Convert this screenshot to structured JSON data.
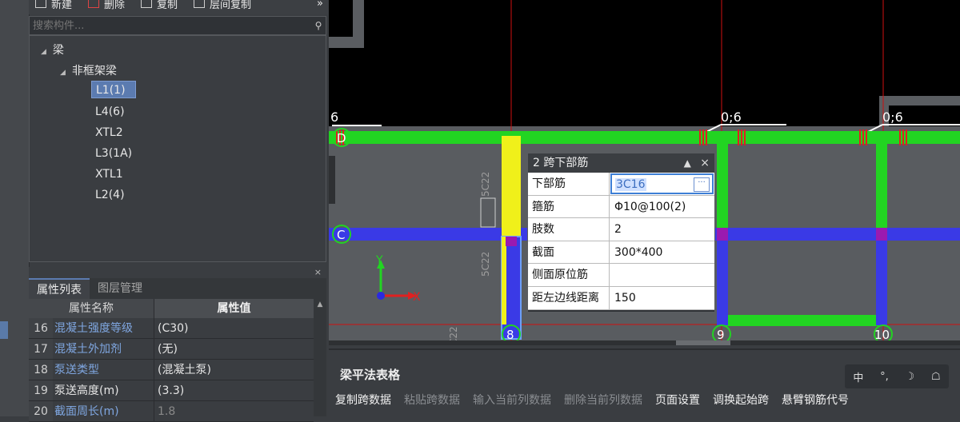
{
  "toolbar": {
    "new_label": "新建",
    "delete_label": "删除",
    "copy_label": "复制",
    "floor_copy_label": "层间复制",
    "more": "»"
  },
  "search": {
    "placeholder": "搜索构件..."
  },
  "tree": {
    "root": "梁",
    "group": "非框架梁",
    "items": [
      "L1(1)",
      "L4(6)",
      "XTL2",
      "L3(1A)",
      "XTL1",
      "L2(4)"
    ]
  },
  "props": {
    "tab_active": "属性列表",
    "tab_other": "图层管理",
    "col_name": "属性名称",
    "col_value": "属性值",
    "close": "×",
    "rows": [
      {
        "num": "16",
        "name": "混凝土强度等级",
        "value": "(C30)"
      },
      {
        "num": "17",
        "name": "混凝土外加剂",
        "value": "(无)"
      },
      {
        "num": "18",
        "name": "泵送类型",
        "value": "(混凝土泵)"
      },
      {
        "num": "19",
        "name": "泵送高度(m)",
        "value": "(3.3)"
      },
      {
        "num": "20",
        "name": "截面周长(m)",
        "value": "1.8"
      }
    ]
  },
  "canvas": {
    "axis_labels": {
      "d": "D",
      "c": "C",
      "n8": "8",
      "n9": "9",
      "n10": "10"
    },
    "dim_left": "6",
    "dim_mid": "0;6",
    "dim_right": "0;6",
    "vtext1": "5C22",
    "vtext2": "5C22",
    "vtext3": "C22",
    "axis_y": "Y",
    "axis_x": "X"
  },
  "dialog": {
    "title": "2 跨下部筋",
    "pin": "▲",
    "close": "×",
    "rows": [
      {
        "name": "下部筋",
        "value": "3C16"
      },
      {
        "name": "箍筋",
        "value": "Φ10@100(2)"
      },
      {
        "name": "肢数",
        "value": "2"
      },
      {
        "name": "截面",
        "value": "300*400"
      },
      {
        "name": "侧面原位筋",
        "value": ""
      },
      {
        "name": "距左边线距离",
        "value": "150"
      }
    ],
    "dots": "···"
  },
  "bottom": {
    "title": "梁平法表格",
    "icons": [
      "中",
      "°,",
      "☽",
      "☖"
    ],
    "actions": [
      {
        "label": "复制跨数据",
        "enabled": true
      },
      {
        "label": "粘贴跨数据",
        "enabled": false
      },
      {
        "label": "输入当前列数据",
        "enabled": false
      },
      {
        "label": "删除当前列数据",
        "enabled": false
      },
      {
        "label": "页面设置",
        "enabled": true
      },
      {
        "label": "调换起始跨",
        "enabled": true
      },
      {
        "label": "悬臂钢筋代号",
        "enabled": true
      }
    ]
  }
}
